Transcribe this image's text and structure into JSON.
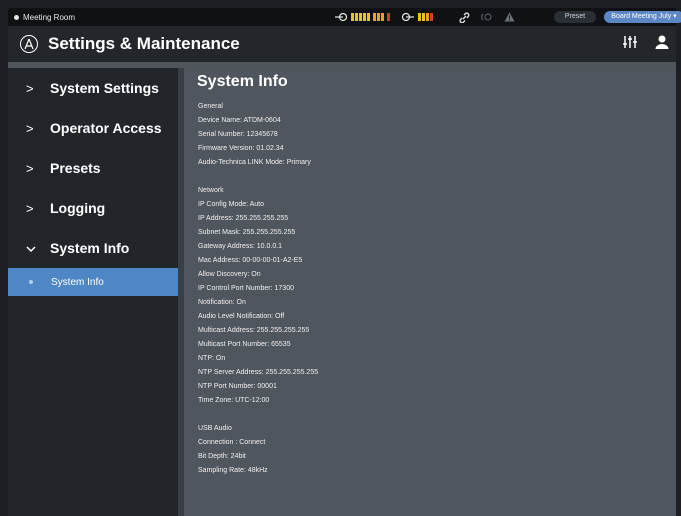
{
  "topbar": {
    "room_name": "Meeting Room",
    "preset_label": "Preset",
    "preset_selected": "Board Meeting July",
    "meter_colors": [
      "#e7c61d",
      "#e7a51d",
      "#d23c2c"
    ]
  },
  "header": {
    "title": "Settings & Maintenance",
    "icons": [
      "audio-technica-logo",
      "sliders-icon",
      "user-icon"
    ]
  },
  "sidebar": {
    "items": [
      {
        "label": "System Settings",
        "expanded": false
      },
      {
        "label": "Operator Access",
        "expanded": false
      },
      {
        "label": "Presets",
        "expanded": false
      },
      {
        "label": "Logging",
        "expanded": false
      },
      {
        "label": "System Info",
        "expanded": true
      }
    ],
    "sub_item": "System Info"
  },
  "main": {
    "title": "System Info",
    "general": {
      "heading": "General",
      "lines": [
        "Device Name: ATDM-0604",
        "Serial Number: 12345678",
        "Firmware Version: 01.02.34",
        "Audio-Technica LINK Mode: Primary"
      ]
    },
    "network": {
      "heading": "Network",
      "lines": [
        "IP Config Mode: Auto",
        "IP Address: 255.255.255.255",
        "Subnet Mask: 255.255.255.255",
        "Gateway Address: 10.0.0.1",
        "Mac Address: 00-00-00-01-A2-E5",
        "Allow Discovery: On",
        "IP Control Port Number: 17300",
        "Notification: On",
        "Audio Level Notification: Off",
        "Multicast Address: 255.255.255.255",
        "Multicast Port Number: 65535",
        "NTP: On",
        "NTP Server Address: 255.255.255.255",
        "NTP Port Number: 00001",
        "Time Zone: UTC-12:00"
      ]
    },
    "usb": {
      "heading": "USB Audio",
      "lines": [
        "Connection : Connect",
        "Bit Depth: 24bit",
        "Sampling Rate: 48kHz"
      ]
    }
  }
}
